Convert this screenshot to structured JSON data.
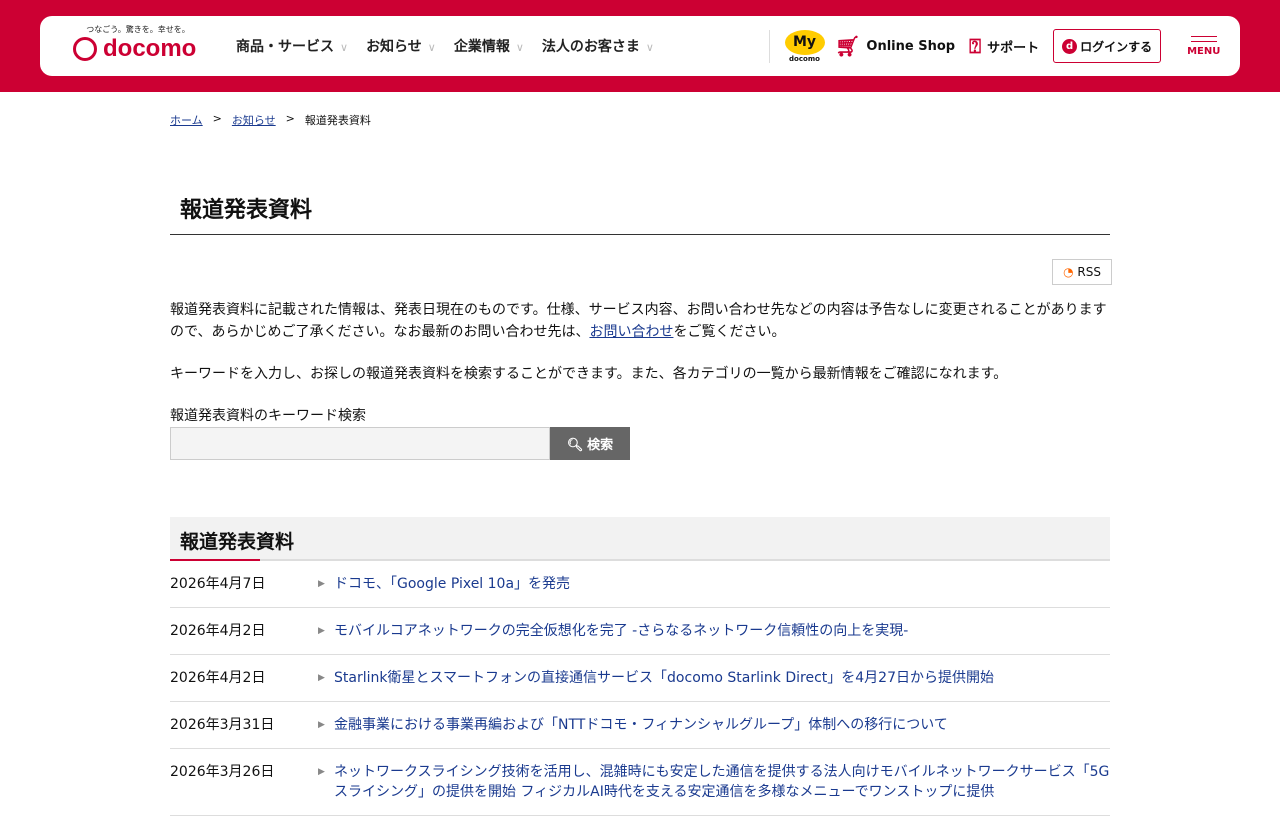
{
  "header": {
    "tagline": "つなごう。驚きを。幸せを。",
    "logo": "docomo",
    "nav": [
      "商品・サービス",
      "お知らせ",
      "企業情報",
      "法人のお客さま"
    ],
    "my": "My",
    "my_sub": "docomo",
    "shop": "Online Shop",
    "support": "サポート",
    "login": "ログインする",
    "menu": "MENU"
  },
  "breadcrumb": [
    "ホーム",
    "お知らせ",
    "報道発表資料"
  ],
  "title": "報道発表資料",
  "rss": "RSS",
  "intro1": "報道発表資料に記載された情報は、発表日現在のものです。仕様、サービス内容、お問い合わせ先などの内容は予告なしに変更されることがありますので、あらかじめご了承ください。なお最新のお問い合わせ先は、",
  "intro_link": "お問い合わせ",
  "intro1_end": "をご覧ください。",
  "intro2": "キーワードを入力し、お探しの報道発表資料を検索することができます。また、各カテゴリの一覧から最新情報をご確認になれます。",
  "search": {
    "label": "報道発表資料のキーワード検索",
    "value": "",
    "button": "検索"
  },
  "list_title": "報道発表資料",
  "items": [
    {
      "date": "2026年4月7日",
      "title": "ドコモ、「Google Pixel 10a」を発売"
    },
    {
      "date": "2026年4月2日",
      "title": "モバイルコアネットワークの完全仮想化を完了 -さらなるネットワーク信頼性の向上を実現-"
    },
    {
      "date": "2026年4月2日",
      "title": "Starlink衛星とスマートフォンの直接通信サービス「docomo Starlink Direct」を4月27日から提供開始"
    },
    {
      "date": "2026年3月31日",
      "title": "金融事業における事業再編および「NTTドコモ・フィナンシャルグループ」体制への移行について"
    },
    {
      "date": "2026年3月26日",
      "title": "ネットワークスライシング技術を活用し、混雑時にも安定した通信を提供する法人向けモバイルネットワークサービス「5Gスライシング」の提供を開始 フィジカルAI時代を支える安定通信を多様なメニューでワンストップに提供"
    }
  ]
}
